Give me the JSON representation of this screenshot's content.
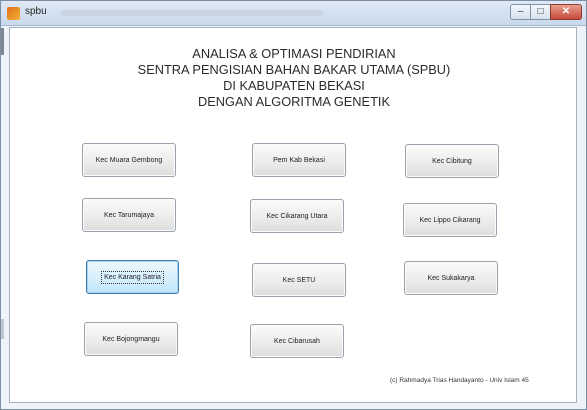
{
  "window": {
    "title": "spbu"
  },
  "heading": {
    "line1": "ANALISA & OPTIMASI PENDIRIAN",
    "line2": "SENTRA PENGISIAN BAHAN BAKAR UTAMA (SPBU)",
    "line3": "DI KABUPATEN BEKASI",
    "line4": "DENGAN ALGORITMA GENETIK"
  },
  "buttons": {
    "muara_gembong": "Kec Muara Gembong",
    "pem_kab_bekasi": "Pem Kab Bekasi",
    "cibitung": "Kec Cibitung",
    "tarumajaya": "Kec Tarumajaya",
    "cikarang_utara": "Kec Cikarang Utara",
    "lippo_cikarang": "Kec Lippo Cikarang",
    "karang_satria": "Kec Karang Satria",
    "setu": "Kec SETU",
    "sukakarya": "Kec Sukakarya",
    "bojongmangu": "Kec Bojongmangu",
    "cibarusah": "Kec Cibarusah"
  },
  "footer": {
    "credit": "(c) Rahmadya Trias Handayanto - Univ Islam 45"
  },
  "icons": {
    "app": "app-icon",
    "minimize": "minimize-icon",
    "maximize": "maximize-icon",
    "close": "close-icon"
  }
}
